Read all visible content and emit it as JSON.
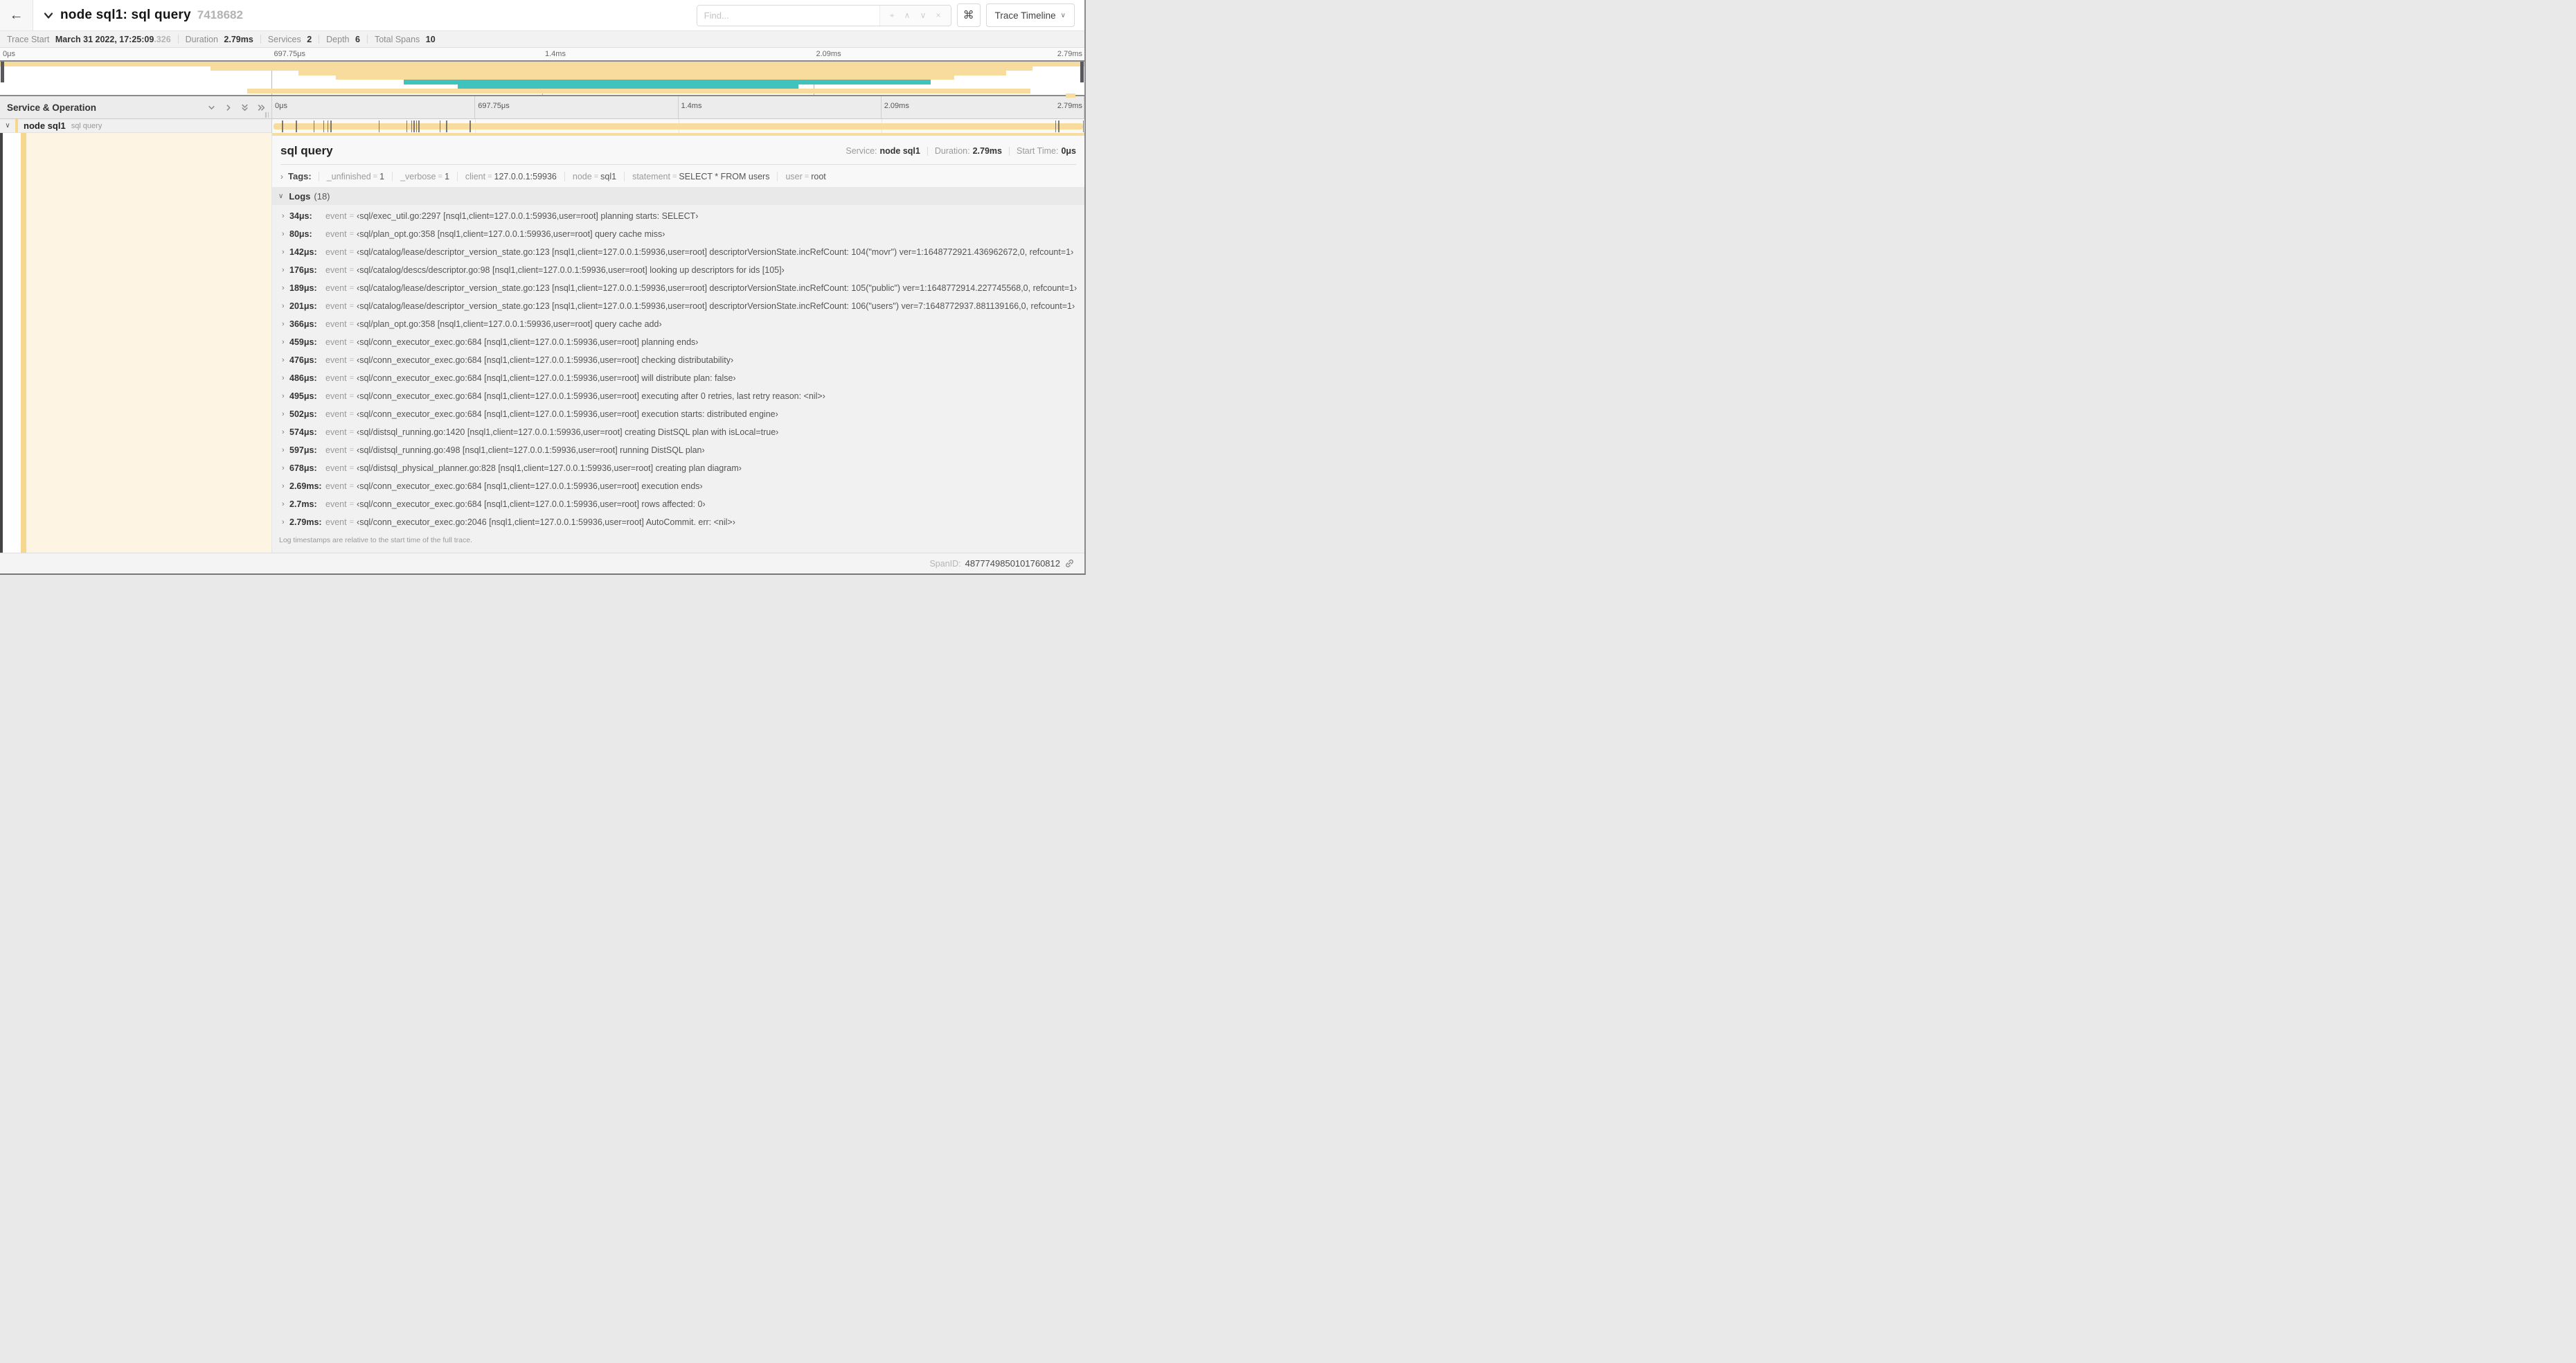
{
  "header": {
    "title": "node sql1: sql query",
    "trace_id_short": "7418682",
    "find_placeholder": "Find...",
    "shortcut_icon": "⌘",
    "view_selector": "Trace Timeline"
  },
  "stats": [
    {
      "label": "Trace Start",
      "value": "March 31 2022, 17:25:09",
      "suffix": ".326"
    },
    {
      "label": "Duration",
      "value": "2.79ms"
    },
    {
      "label": "Services",
      "value": "2"
    },
    {
      "label": "Depth",
      "value": "6"
    },
    {
      "label": "Total Spans",
      "value": "10"
    }
  ],
  "colors": {
    "tan": "#F7DC9E",
    "teal": "#3EC3BF",
    "accent_stripe": "#F5D78F",
    "selected_detail_bg": "#FDF4E3"
  },
  "minimap": {
    "ticks": [
      "0μs",
      "697.75μs",
      "1.4ms",
      "2.09ms",
      "2.79ms"
    ],
    "bars": [
      {
        "row": 0,
        "left": 0,
        "width": 100,
        "color": "tan"
      },
      {
        "row": 1,
        "left": 19.4,
        "width": 75.8,
        "color": "tan"
      },
      {
        "row": 2,
        "left": 27.5,
        "width": 65.3,
        "color": "tan"
      },
      {
        "row": 3,
        "left": 31.0,
        "width": 57.0,
        "color": "tan"
      },
      {
        "row": 4,
        "left": 37.2,
        "width": 48.6,
        "color": "teal"
      },
      {
        "row": 5,
        "left": 42.2,
        "width": 31.4,
        "color": "teal"
      },
      {
        "row": 6,
        "left": 22.8,
        "width": 72.2,
        "color": "tan"
      },
      {
        "row": 7,
        "left": 98.3,
        "width": 0.9,
        "color": "tan"
      }
    ]
  },
  "timeline": {
    "left_header": "Service & Operation",
    "ticks": [
      "0μs",
      "697.75μs",
      "1.4ms",
      "2.09ms",
      "2.79ms"
    ],
    "span": {
      "service": "node sql1",
      "operation": "sql query"
    },
    "log_marker_positions_pct": [
      1.2,
      2.9,
      5.1,
      6.3,
      6.8,
      7.2,
      13.1,
      16.5,
      17.1,
      17.4,
      17.7,
      18.0,
      20.6,
      21.4,
      24.3,
      96.4,
      96.8,
      99.8
    ]
  },
  "detail": {
    "title": "sql query",
    "meta": [
      {
        "label": "Service:",
        "value": "node sql1"
      },
      {
        "label": "Duration:",
        "value": "2.79ms"
      },
      {
        "label": "Start Time:",
        "value": "0μs"
      }
    ],
    "tags_label": "Tags:",
    "tags": [
      {
        "key": "_unfinished",
        "value": "1"
      },
      {
        "key": "_verbose",
        "value": "1"
      },
      {
        "key": "client",
        "value": "127.0.0.1:59936"
      },
      {
        "key": "node",
        "value": "sql1"
      },
      {
        "key": "statement",
        "value": "SELECT * FROM users"
      },
      {
        "key": "user",
        "value": "root"
      }
    ],
    "logs_label": "Logs",
    "logs_count": "(18)",
    "logs": [
      {
        "time": "34μs:",
        "field": "event",
        "value": "‹sql/exec_util.go:2297 [nsql1,client=127.0.0.1:59936,user=root] planning starts: SELECT›"
      },
      {
        "time": "80μs:",
        "field": "event",
        "value": "‹sql/plan_opt.go:358 [nsql1,client=127.0.0.1:59936,user=root] query cache miss›"
      },
      {
        "time": "142μs:",
        "field": "event",
        "value": "‹sql/catalog/lease/descriptor_version_state.go:123 [nsql1,client=127.0.0.1:59936,user=root] descriptorVersionState.incRefCount: 104(\"movr\") ver=1:1648772921.436962672,0, refcount=1›"
      },
      {
        "time": "176μs:",
        "field": "event",
        "value": "‹sql/catalog/descs/descriptor.go:98 [nsql1,client=127.0.0.1:59936,user=root] looking up descriptors for ids [105]›"
      },
      {
        "time": "189μs:",
        "field": "event",
        "value": "‹sql/catalog/lease/descriptor_version_state.go:123 [nsql1,client=127.0.0.1:59936,user=root] descriptorVersionState.incRefCount: 105(\"public\") ver=1:1648772914.227745568,0, refcount=1›"
      },
      {
        "time": "201μs:",
        "field": "event",
        "value": "‹sql/catalog/lease/descriptor_version_state.go:123 [nsql1,client=127.0.0.1:59936,user=root] descriptorVersionState.incRefCount: 106(\"users\") ver=7:1648772937.881139166,0, refcount=1›"
      },
      {
        "time": "366μs:",
        "field": "event",
        "value": "‹sql/plan_opt.go:358 [nsql1,client=127.0.0.1:59936,user=root] query cache add›"
      },
      {
        "time": "459μs:",
        "field": "event",
        "value": "‹sql/conn_executor_exec.go:684 [nsql1,client=127.0.0.1:59936,user=root] planning ends›"
      },
      {
        "time": "476μs:",
        "field": "event",
        "value": "‹sql/conn_executor_exec.go:684 [nsql1,client=127.0.0.1:59936,user=root] checking distributability›"
      },
      {
        "time": "486μs:",
        "field": "event",
        "value": "‹sql/conn_executor_exec.go:684 [nsql1,client=127.0.0.1:59936,user=root] will distribute plan: false›"
      },
      {
        "time": "495μs:",
        "field": "event",
        "value": "‹sql/conn_executor_exec.go:684 [nsql1,client=127.0.0.1:59936,user=root] executing after 0 retries, last retry reason: <nil>›"
      },
      {
        "time": "502μs:",
        "field": "event",
        "value": "‹sql/conn_executor_exec.go:684 [nsql1,client=127.0.0.1:59936,user=root] execution starts: distributed engine›"
      },
      {
        "time": "574μs:",
        "field": "event",
        "value": "‹sql/distsql_running.go:1420 [nsql1,client=127.0.0.1:59936,user=root] creating DistSQL plan with isLocal=true›"
      },
      {
        "time": "597μs:",
        "field": "event",
        "value": "‹sql/distsql_running.go:498 [nsql1,client=127.0.0.1:59936,user=root] running DistSQL plan›"
      },
      {
        "time": "678μs:",
        "field": "event",
        "value": "‹sql/distsql_physical_planner.go:828 [nsql1,client=127.0.0.1:59936,user=root] creating plan diagram›"
      },
      {
        "time": "2.69ms:",
        "field": "event",
        "value": "‹sql/conn_executor_exec.go:684 [nsql1,client=127.0.0.1:59936,user=root] execution ends›"
      },
      {
        "time": "2.7ms:",
        "field": "event",
        "value": "‹sql/conn_executor_exec.go:684 [nsql1,client=127.0.0.1:59936,user=root] rows affected: 0›"
      },
      {
        "time": "2.79ms:",
        "field": "event",
        "value": "‹sql/conn_executor_exec.go:2046 [nsql1,client=127.0.0.1:59936,user=root] AutoCommit. err: <nil>›"
      }
    ],
    "logs_note": "Log timestamps are relative to the start time of the full trace.",
    "footer_label": "SpanID:",
    "footer_value": "4877749850101760812"
  }
}
